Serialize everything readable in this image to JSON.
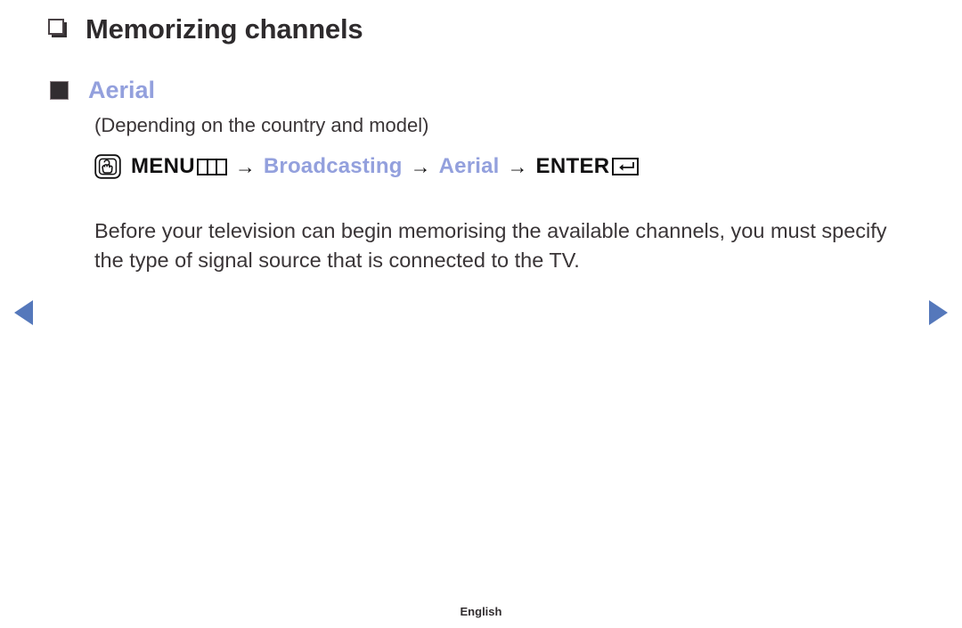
{
  "document": {
    "title": "Memorizing channels",
    "title_bullet_icon": "hollow-square-3d-bullet-icon"
  },
  "section": {
    "heading": "Aerial",
    "heading_bullet_icon": "filled-square-bullet-icon",
    "note": "(Depending on the country and model)",
    "accent_color": "#93a0dd"
  },
  "menu_path": {
    "touch_icon": "hand-press-button-icon",
    "steps": [
      {
        "label": "MENU",
        "style": "strong",
        "glyph": "menu-bars-glyph"
      },
      {
        "label": "Broadcasting",
        "style": "accent",
        "glyph": ""
      },
      {
        "label": "Aerial",
        "style": "accent",
        "glyph": ""
      },
      {
        "label": "ENTER",
        "style": "strong",
        "glyph": "enter-return-glyph"
      }
    ],
    "separator": "→"
  },
  "body": {
    "paragraph": "Before your television can begin memorising the available channels, you must specify the type of signal source that is connected to the TV."
  },
  "navigation": {
    "prev_icon": "left-triangle-arrow-icon",
    "next_icon": "right-triangle-arrow-icon",
    "arrow_color": "#5578bb"
  },
  "footer": {
    "language": "English"
  }
}
